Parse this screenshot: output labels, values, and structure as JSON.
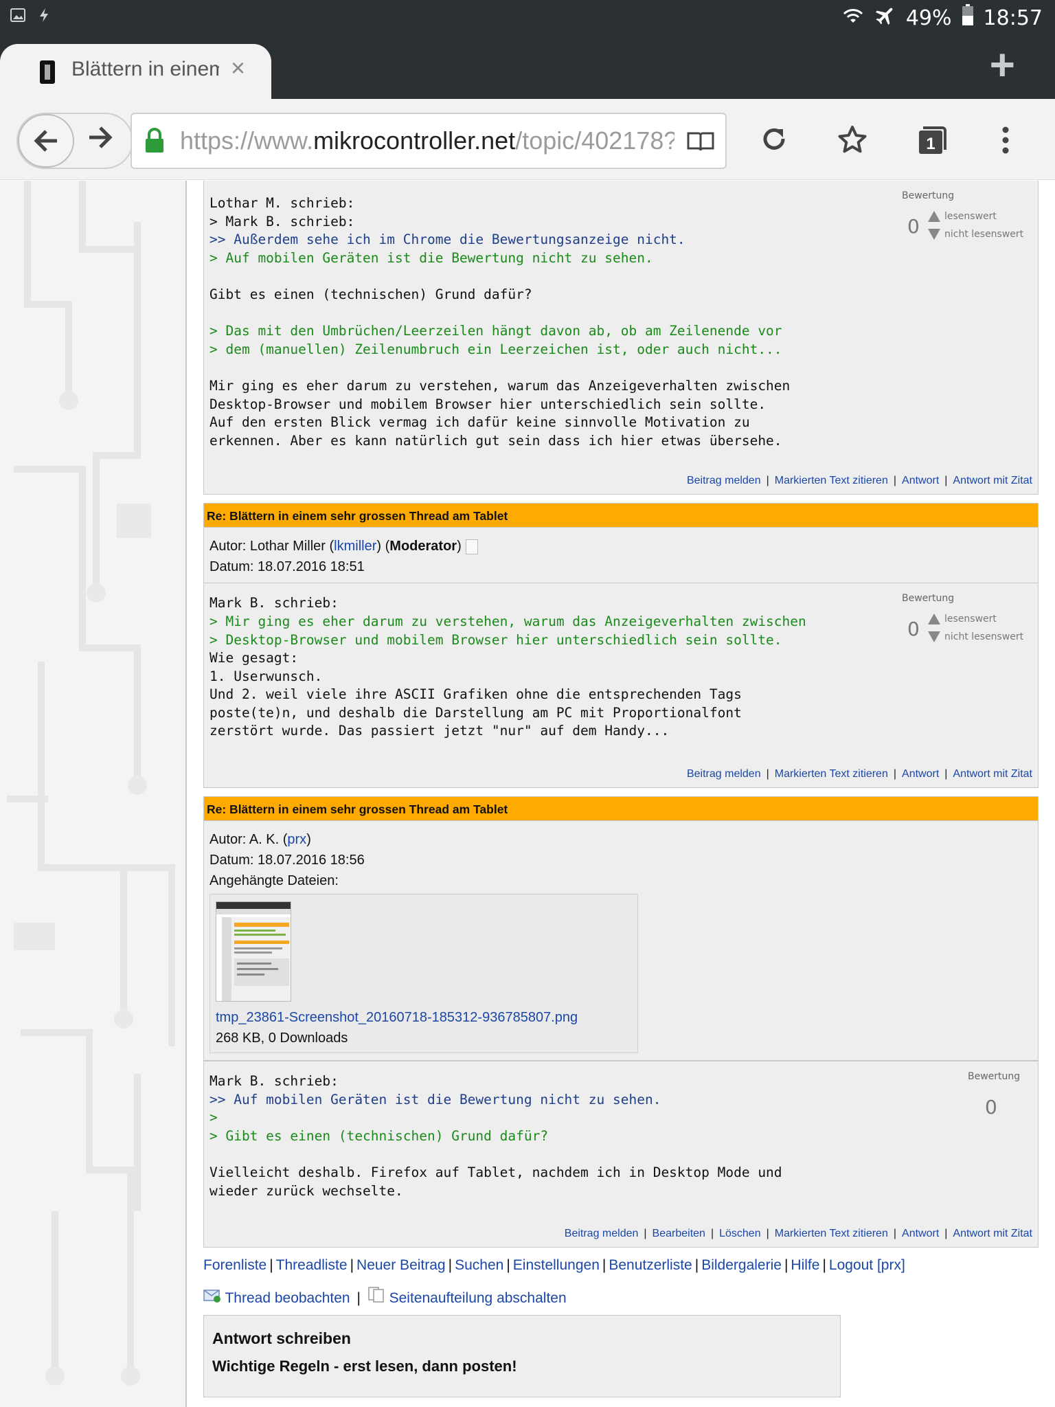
{
  "status_bar": {
    "battery": "49%",
    "time": "18:57"
  },
  "browser": {
    "tab_title": "Blättern in einem",
    "close_symbol": "×",
    "new_tab_symbol": "+",
    "url_host_prefix": "https://www.",
    "url_host": "mikrocontroller.net",
    "url_path": "/topic/402178?",
    "tab_count": "1"
  },
  "rating_labels": {
    "title": "Bewertung",
    "up": "lesenswert",
    "down": "nicht lesenswert"
  },
  "actions": {
    "report": "Beitrag melden",
    "quote_marked": "Markierten Text zitieren",
    "reply": "Antwort",
    "reply_quote": "Antwort mit Zitat",
    "edit": "Bearbeiten",
    "delete": "Löschen",
    "sep": "|"
  },
  "posts": [
    {
      "rating": "0",
      "lines": [
        {
          "t": "Lothar M. schrieb:",
          "c": ""
        },
        {
          "t": "> Mark B. schrieb:",
          "c": ""
        },
        {
          "t": ">> Außerdem sehe ich im Chrome die Bewertungsanzeige nicht.",
          "c": "q1 dark"
        },
        {
          "t": "> Auf mobilen Geräten ist die Bewertung nicht zu sehen.",
          "c": "q2"
        },
        {
          "t": " ",
          "c": ""
        },
        {
          "t": "Gibt es einen (technischen) Grund dafür?",
          "c": ""
        },
        {
          "t": " ",
          "c": ""
        },
        {
          "t": "> Das mit den Umbrüchen/Leerzeilen hängt davon ab, ob am Zeilenende vor",
          "c": "q2"
        },
        {
          "t": "> dem (manuellen) Zeilenumbruch ein Leerzeichen ist, oder auch nicht...",
          "c": "q2"
        },
        {
          "t": " ",
          "c": ""
        },
        {
          "t": "Mir ging es eher darum zu verstehen, warum das Anzeigeverhalten zwischen",
          "c": ""
        },
        {
          "t": "Desktop-Browser und mobilem Browser hier unterschiedlich sein sollte.",
          "c": ""
        },
        {
          "t": "Auf den ersten Blick vermag ich dafür keine sinnvolle Motivation zu",
          "c": ""
        },
        {
          "t": "erkennen. Aber es kann natürlich gut sein dass ich hier etwas übersehe.",
          "c": ""
        }
      ]
    },
    {
      "header": "Re: Blättern in einem sehr grossen Thread am Tablet",
      "author_prefix": "Autor: Lothar Miller (",
      "author_user": "lkmiller",
      "author_mid": ") (",
      "author_role": "Moderator",
      "author_suffix": ")",
      "date": "Datum: 18.07.2016 18:51",
      "rating": "0",
      "lines": [
        {
          "t": "Mark B. schrieb:",
          "c": ""
        },
        {
          "t": "> Mir ging es eher darum zu verstehen, warum das Anzeigeverhalten zwischen",
          "c": "q2"
        },
        {
          "t": "> Desktop-Browser und mobilem Browser hier unterschiedlich sein sollte.",
          "c": "q2"
        },
        {
          "t": "Wie gesagt:",
          "c": ""
        },
        {
          "t": "1. Userwunsch.",
          "c": ""
        },
        {
          "t": "Und 2. weil viele ihre ASCII Grafiken ohne die entsprechenden Tags",
          "c": ""
        },
        {
          "t": "poste(te)n, und deshalb die Darstellung am PC mit Proportionalfont",
          "c": ""
        },
        {
          "t": "zerstört wurde. Das passiert jetzt \"nur\" auf dem Handy...",
          "c": ""
        }
      ]
    },
    {
      "header": "Re: Blättern in einem sehr grossen Thread am Tablet",
      "author_prefix": "Autor: A. K. (",
      "author_user": "prx",
      "author_suffix": ")",
      "date": "Datum: 18.07.2016 18:56",
      "attachments_label": "Angehängte Dateien:",
      "attachment_name": "tmp_23861-Screenshot_20160718-185312-936785807.png",
      "attachment_info": "268 KB, 0 Downloads",
      "rating": "0",
      "lines": [
        {
          "t": "Mark B. schrieb:",
          "c": ""
        },
        {
          "t": ">> Auf mobilen Geräten ist die Bewertung nicht zu sehen.",
          "c": "q1 dark"
        },
        {
          "t": ">",
          "c": "q2"
        },
        {
          "t": "> Gibt es einen (technischen) Grund dafür?",
          "c": "q2"
        },
        {
          "t": " ",
          "c": ""
        },
        {
          "t": "Vielleicht deshalb. Firefox auf Tablet, nachdem ich in Desktop Mode und",
          "c": ""
        },
        {
          "t": "wieder zurück wechselte.",
          "c": ""
        }
      ]
    }
  ],
  "footer": {
    "links": [
      "Forenliste",
      "Threadliste",
      "Neuer Beitrag",
      "Suchen",
      "Einstellungen",
      "Benutzerliste",
      "Bildergalerie",
      "Hilfe",
      "Logout [prx]"
    ],
    "watch": "Thread beobachten",
    "paging": "Seitenaufteilung abschalten",
    "reply_title": "Antwort schreiben",
    "rules": "Wichtige Regeln - erst lesen, dann posten!"
  }
}
